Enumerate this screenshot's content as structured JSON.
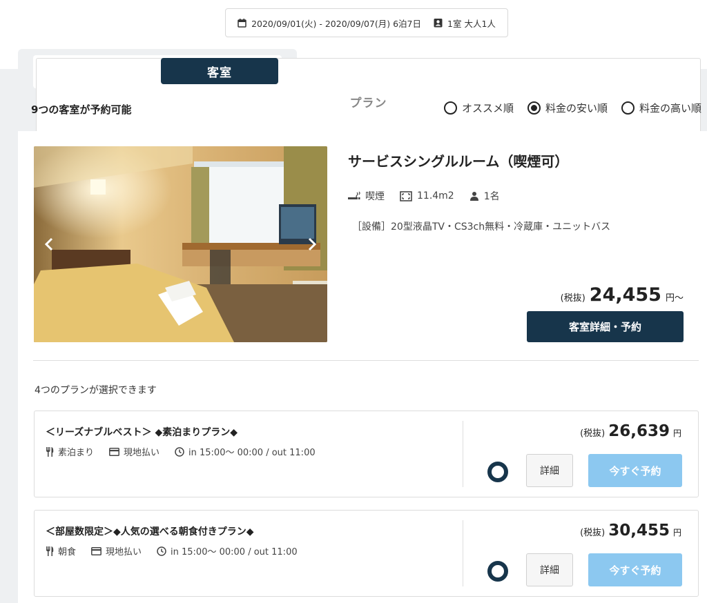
{
  "search_summary": {
    "dates": "2020/09/01(火) - 2020/09/07(月) 6泊7日",
    "guests": "1室 大人1人"
  },
  "tabs": [
    {
      "label": "プラン",
      "active": false
    },
    {
      "label": "客室",
      "active": true
    }
  ],
  "results": {
    "available_text": "9つの客室が予約可能",
    "sort_options": [
      {
        "label": "オススメ順",
        "selected": false
      },
      {
        "label": "料金の安い順",
        "selected": true
      },
      {
        "label": "料金の高い順",
        "selected": false
      }
    ]
  },
  "room": {
    "name": "サービスシングルルーム（喫煙可）",
    "smoking": "喫煙",
    "size": "11.4m2",
    "capacity": "1名",
    "amenities": "［設備］20型液晶TV・CS3ch無料・冷蔵庫・ユニットバス",
    "tax_label": "(税抜)",
    "price": "24,455",
    "price_suffix": "円〜",
    "detail_button": "客室詳細・予約"
  },
  "plans_count": "4つのプランが選択できます",
  "plans": [
    {
      "name": "＜リーズナブルベスト＞ ◆素泊まりプラン◆",
      "meal": "素泊まり",
      "payment": "現地払い",
      "time": "in 15:00〜 00:00 / out 11:00",
      "tax_label": "(税抜)",
      "price": "26,639",
      "yen": "円",
      "detail_button": "詳細",
      "reserve_button": "今すぐ予約"
    },
    {
      "name": "＜部屋数限定＞◆人気の選べる朝食付きプラン◆",
      "meal": "朝食",
      "payment": "現地払い",
      "time": "in 15:00〜 00:00 / out 11:00",
      "tax_label": "(税抜)",
      "price": "30,455",
      "yen": "円",
      "detail_button": "詳細",
      "reserve_button": "今すぐ予約"
    }
  ],
  "colors": {
    "primary": "#17354b",
    "reserve_button": "#8cc8f0",
    "background_gray": "#eef0f2"
  }
}
